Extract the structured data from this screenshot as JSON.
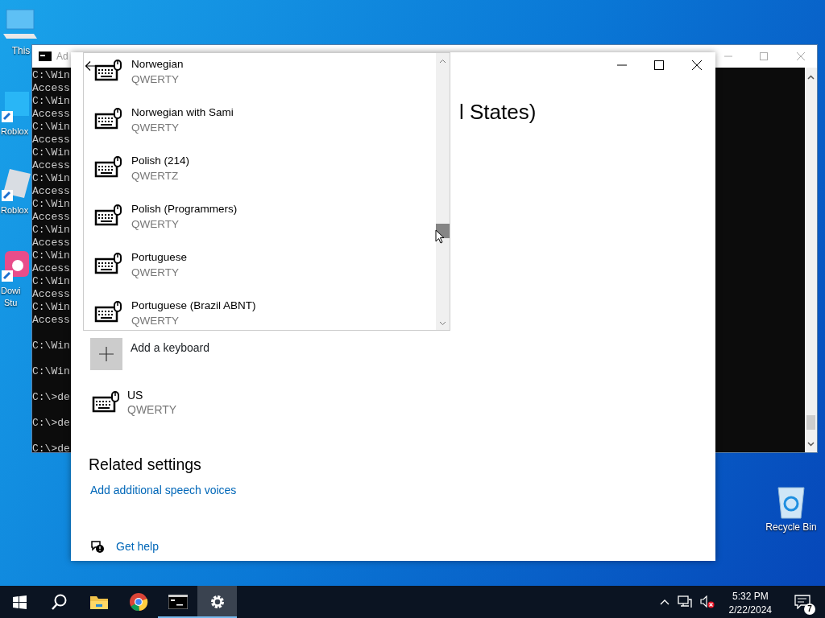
{
  "desktop_icons": [
    {
      "kind": "computer",
      "label": "This"
    },
    {
      "kind": "app-blue",
      "label": "Roblox"
    },
    {
      "kind": "app-grey",
      "label": "Roblox"
    },
    {
      "kind": "app-pink",
      "label": "Dowi\nStu"
    },
    {
      "kind": "recycle",
      "label": "Recycle Bin"
    }
  ],
  "console_window": {
    "title": "Ad",
    "lines": [
      {
        "text": "C:\\Win",
        "blank_before": false
      },
      {
        "text": "Access",
        "blank_before": false
      },
      {
        "text": "C:\\Win",
        "blank_before": false
      },
      {
        "text": "Access",
        "blank_before": false
      },
      {
        "text": "C:\\Win",
        "blank_before": false
      },
      {
        "text": "Access",
        "blank_before": false
      },
      {
        "text": "C:\\Win",
        "blank_before": false
      },
      {
        "text": "Access",
        "blank_before": false
      },
      {
        "text": "C:\\Win",
        "blank_before": false
      },
      {
        "text": "Access",
        "blank_before": false
      },
      {
        "text": "C:\\Win",
        "blank_before": false
      },
      {
        "text": "Access",
        "blank_before": false
      },
      {
        "text": "C:\\Win",
        "blank_before": false
      },
      {
        "text": "Access",
        "blank_before": false
      },
      {
        "text": "C:\\Win",
        "blank_before": false
      },
      {
        "text": "Access",
        "blank_before": false
      },
      {
        "text": "C:\\Win",
        "blank_before": false
      },
      {
        "text": "Access",
        "blank_before": false
      },
      {
        "text": "C:\\Win",
        "blank_before": false
      },
      {
        "text": "Access",
        "blank_before": false
      },
      {
        "text": "C:\\Win",
        "blank_before": true
      },
      {
        "text": "C:\\Win",
        "blank_before": true
      },
      {
        "text": "C:\\>de",
        "blank_before": true
      },
      {
        "text": "C:\\>de",
        "blank_before": true
      },
      {
        "text": "C:\\>de",
        "blank_before": true
      }
    ]
  },
  "settings_window": {
    "heading": "l States)",
    "keyboard_picker": {
      "items": [
        {
          "name": "Norwegian",
          "layout": "QWERTY"
        },
        {
          "name": "Norwegian with Sami",
          "layout": "QWERTY"
        },
        {
          "name": "Polish (214)",
          "layout": "QWERTZ"
        },
        {
          "name": "Polish (Programmers)",
          "layout": "QWERTY"
        },
        {
          "name": "Portuguese",
          "layout": "QWERTY"
        },
        {
          "name": "Portuguese (Brazil ABNT)",
          "layout": "QWERTY"
        }
      ]
    },
    "add_keyboard": "Add a keyboard",
    "keyboards": [
      {
        "name": "US",
        "layout": "QWERTY"
      }
    ],
    "related_settings": {
      "title": "Related settings",
      "links": [
        "Add additional speech voices"
      ]
    },
    "help": "Get help"
  },
  "taskbar": {
    "apps": [
      {
        "kind": "start",
        "running": false,
        "selected": false
      },
      {
        "kind": "search",
        "running": false,
        "selected": false
      },
      {
        "kind": "folder",
        "running": false,
        "selected": false
      },
      {
        "kind": "browser",
        "running": false,
        "selected": false
      },
      {
        "kind": "terminal",
        "running": true,
        "selected": false
      },
      {
        "kind": "settings",
        "running": true,
        "selected": true
      }
    ],
    "time": "5:32 PM",
    "date": "2/22/2024",
    "notifications": "7"
  }
}
